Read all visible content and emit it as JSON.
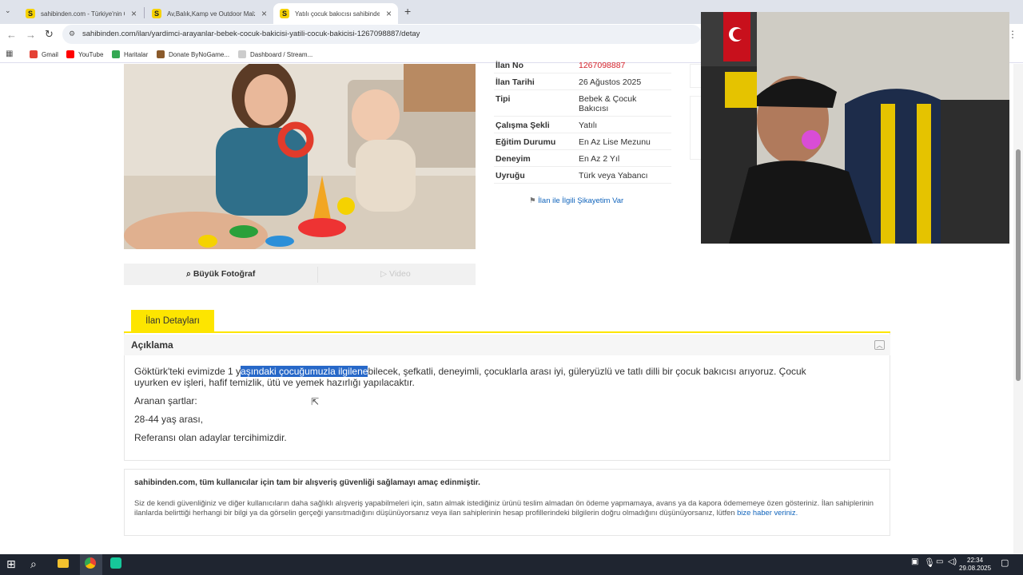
{
  "browser": {
    "tabs": [
      {
        "title": "sahibinden.com - Türkiye'nin Ön",
        "active": false
      },
      {
        "title": "Av,Balık,Kamp ve Outdoor Malz",
        "active": false
      },
      {
        "title": "Yatılı çocuk bakıcısı sahibinden",
        "active": true
      }
    ],
    "url": "sahibinden.com/ilan/yardimci-arayanlar-bebek-cocuk-bakicisi-yatili-cocuk-bakicisi-1267098887/detay",
    "bookmarks": [
      "Gmail",
      "YouTube",
      "Haritalar",
      "Donate ByNoGame...",
      "Dashboard / Stream..."
    ]
  },
  "listing": {
    "photo_actions": {
      "big_photo": "Büyük Fotoğraf",
      "video": "Video"
    },
    "info_rows": [
      {
        "label": "İlan No",
        "value": "1267098887"
      },
      {
        "label": "İlan Tarihi",
        "value": "26 Ağustos 2025"
      },
      {
        "label": "Tipi",
        "value": "Bebek & Çocuk Bakıcısı"
      },
      {
        "label": "Çalışma Şekli",
        "value": "Yatılı"
      },
      {
        "label": "Eğitim Durumu",
        "value": "En Az Lise Mezunu"
      },
      {
        "label": "Deneyim",
        "value": "En Az 2 Yıl"
      },
      {
        "label": "Uyruğu",
        "value": "Türk veya Yabancı"
      }
    ],
    "complaint_link": "İlan ile İlgili Şikayetim Var",
    "details_tab": "İlan Detayları",
    "description": {
      "title": "Açıklama",
      "line1_pre": "Göktürk'teki evimizde 1 y",
      "line1_highlight": "aşındaki çocuğumuzla ilgilene",
      "line1_post": "bilecek, şefkatli, deneyimli, çocuklarla arası iyi, güleryüzlü ve tatlı dilli bir çocuk bakıcısı arıyoruz. Çocuk",
      "line2": "uyurken ev işleri, hafif temizlik, ütü ve yemek hazırlığı yapılacaktır.",
      "req_title": "Aranan şartlar:",
      "req_age": "28-44 yaş arası,",
      "req_ref": "Referansı olan adaylar tercihimizdir."
    },
    "notice": {
      "title": "sahibinden.com, tüm kullanıcılar için tam bir alışveriş güvenliği sağlamayı amaç edinmiştir.",
      "body": "Siz de kendi güvenliğiniz ve diğer kullanıcıların daha sağlıklı alışveriş yapabilmeleri için, satın almak istediğiniz ürünü teslim almadan ön ödeme yapmamaya, avans ya da kapora ödememeye özen gösteriniz. İlan sahiplerinin ilanlarda belirttiği herhangi bir bilgi ya da görselin gerçeği yansıtmadığını düşünüyorsanız veya ilan sahiplerinin hesap profillerindeki bilgilerin doğru olmadığını düşünüyorsanız, lütfen ",
      "link": "bize haber veriniz."
    }
  },
  "taskbar": {
    "time": "22:34",
    "date": "29.08.2025"
  },
  "colors": {
    "accent": "#fde500",
    "link": "#1064bc",
    "id_red": "#d4232b"
  }
}
